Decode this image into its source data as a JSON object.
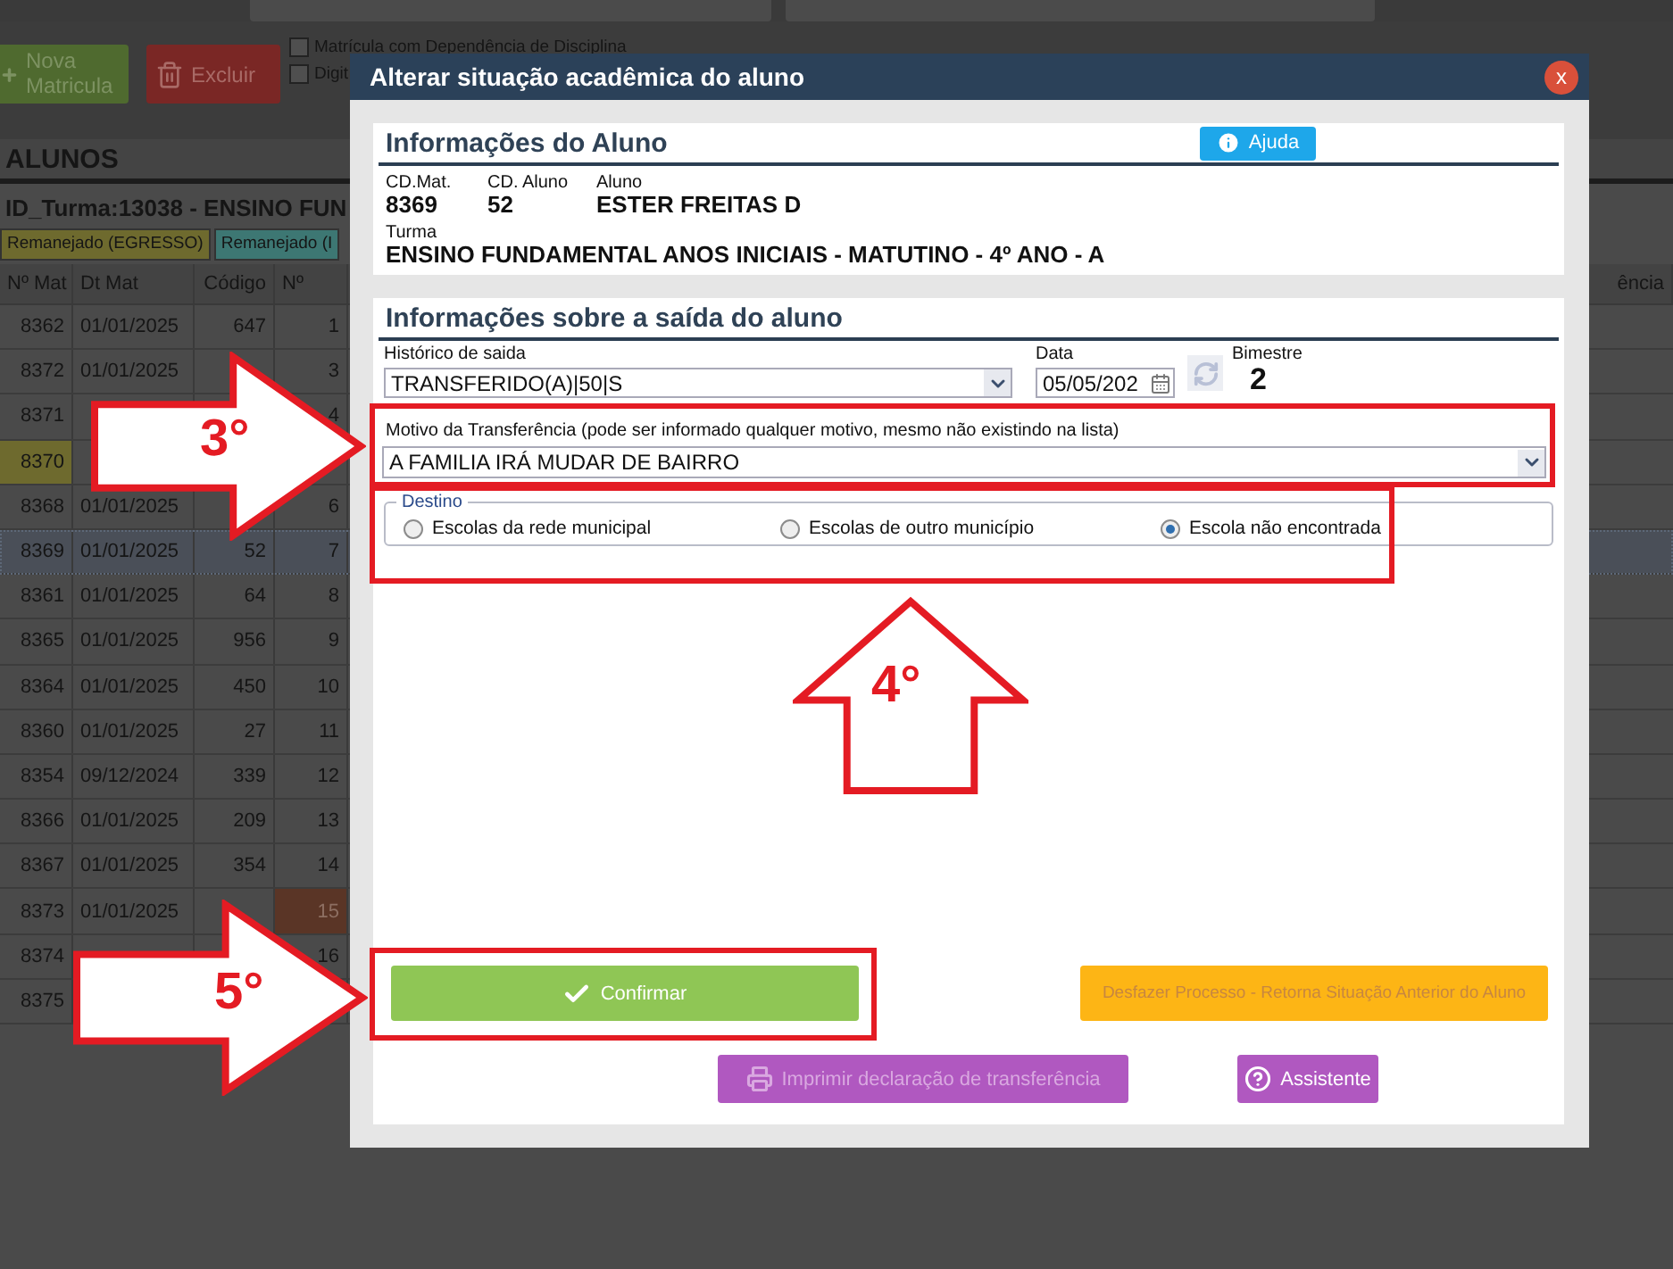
{
  "background": {
    "toolbar": {
      "buttons": [
        {
          "kind": "add",
          "label": "Nova Matricula"
        },
        {
          "kind": "delete",
          "label": "Excluir"
        }
      ],
      "checkboxes": [
        {
          "label": "Matrícula com Dependência de Disciplina",
          "checked": false
        },
        {
          "label": "Digit",
          "checked": false
        }
      ]
    },
    "section_title": "ALUNOS",
    "class_title": "ID_Turma:13038 - ENSINO FUN",
    "legend": [
      {
        "label": "Remanejado (EGRESSO)",
        "color": "#6e6a2e"
      },
      {
        "label": "Remanejado (I",
        "color": "#3d7773"
      }
    ],
    "table": {
      "columns": [
        "Nº Mat",
        "Dt Mat",
        "Código",
        "Nº",
        "ência"
      ],
      "rows": [
        {
          "kind": "plain",
          "mat": "8362",
          "date": "01/01/2025",
          "code": "647",
          "number": "1",
          "selected": false
        },
        {
          "kind": "plain",
          "mat": "8372",
          "date": "01/01/2025",
          "number": "3",
          "selected": false
        },
        {
          "kind": "plain",
          "mat": "8371",
          "number": "4",
          "selected": false
        },
        {
          "kind": "status",
          "mat": "8370",
          "color": "#6e6a2e",
          "selected": false
        },
        {
          "kind": "plain",
          "mat": "8368",
          "date": "01/01/2025",
          "number": "6",
          "selected": false
        },
        {
          "kind": "plain",
          "mat": "8369",
          "date": "01/01/2025",
          "code": "52",
          "number": "7",
          "selected": true
        },
        {
          "kind": "plain",
          "mat": "8361",
          "date": "01/01/2025",
          "code": "64",
          "number": "8",
          "selected": false
        },
        {
          "kind": "plain",
          "mat": "8365",
          "date": "01/01/2025",
          "code": "956",
          "number": "9",
          "selected": false
        },
        {
          "kind": "plain",
          "mat": "8364",
          "date": "01/01/2025",
          "code": "450",
          "number": "10",
          "selected": false
        },
        {
          "kind": "plain",
          "mat": "8360",
          "date": "01/01/2025",
          "code": "27",
          "number": "11",
          "selected": false
        },
        {
          "kind": "plain",
          "mat": "8354",
          "date": "09/12/2024",
          "code": "339",
          "number": "12",
          "selected": false
        },
        {
          "kind": "plain",
          "mat": "8366",
          "date": "01/01/2025",
          "code": "209",
          "number": "13",
          "selected": false
        },
        {
          "kind": "plain",
          "mat": "8367",
          "date": "01/01/2025",
          "code": "354",
          "number": "14",
          "selected": false
        },
        {
          "kind": "flag",
          "mat": "8373",
          "date": "01/01/2025",
          "number": "15",
          "color": "#5a3526",
          "selected": false
        },
        {
          "kind": "plain",
          "mat": "8374",
          "number": "16",
          "selected": false
        },
        {
          "kind": "plain",
          "mat": "8375",
          "selected": false
        }
      ]
    }
  },
  "dialog": {
    "title": "Alterar situação acadêmica do aluno",
    "close": "x",
    "student_info": {
      "title": "Informações do Aluno",
      "help_button": "Ajuda",
      "fields": [
        {
          "label": "CD.Mat.",
          "value": "8369"
        },
        {
          "label": "CD. Aluno",
          "value": "52"
        },
        {
          "label": "Aluno",
          "value": "ESTER FREITAS D"
        }
      ],
      "class": {
        "label": "Turma",
        "value": "ENSINO FUNDAMENTAL ANOS INICIAIS - MATUTINO - 4º ANO - A"
      }
    },
    "exit_info": {
      "title": "Informações sobre a saída do aluno",
      "history": {
        "label": "Histórico de saida",
        "value": "TRANSFERIDO(A)|50|S"
      },
      "date": {
        "label": "Data",
        "value": "05/05/202"
      },
      "refresh": {
        "disabled": true
      },
      "bimester": {
        "label": "Bimestre",
        "value": "2"
      },
      "reason": {
        "label": "Motivo da Transferência (pode ser informado qualquer motivo, mesmo não existindo na lista)",
        "value": "A FAMILIA IRÁ MUDAR DE BAIRRO"
      },
      "destination": {
        "legend": "Destino",
        "options": [
          {
            "label": "Escolas da rede municipal",
            "selected": false
          },
          {
            "label": "Escolas de outro município",
            "selected": false
          },
          {
            "label": "Escola não encontrada",
            "selected": true
          }
        ]
      },
      "buttons": [
        {
          "kind": "confirm",
          "label": "Confirmar",
          "disabled": false
        },
        {
          "kind": "undo",
          "label": "Desfazer Processo - Retorna Situação Anterior do Aluno",
          "disabled": true
        },
        {
          "kind": "print",
          "label": "Imprimir declaração de transferência",
          "disabled": true
        },
        {
          "kind": "assistant",
          "label": "Assistente",
          "disabled": false
        }
      ]
    }
  },
  "annotations": [
    {
      "label": "3°",
      "kind": "right"
    },
    {
      "label": "4°",
      "kind": "up"
    },
    {
      "label": "5°",
      "kind": "right"
    }
  ]
}
